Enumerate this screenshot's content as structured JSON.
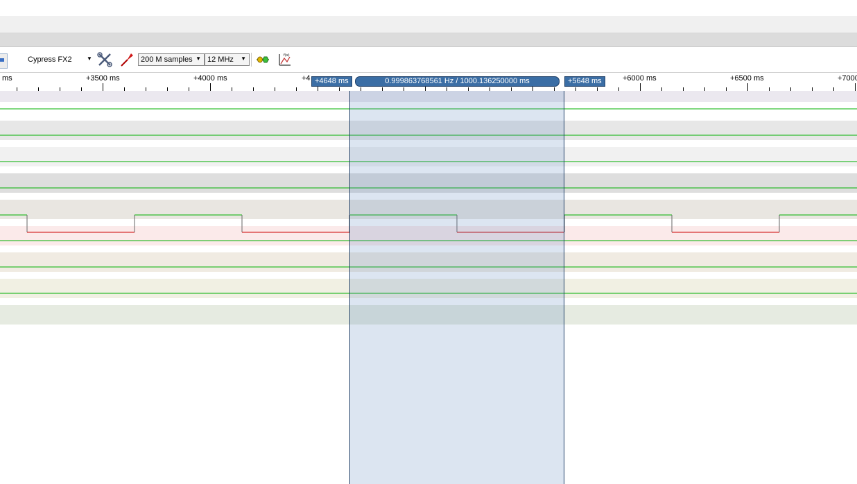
{
  "toolbar": {
    "device": "Cypress FX2",
    "samples": "200 M samples",
    "samplerate": "12 MHz",
    "icons": [
      "configure-tools-icon",
      "probe-icon",
      "decoder-icon",
      "math-function-icon"
    ]
  },
  "ruler": {
    "labels": [
      "ms",
      "+3500 ms",
      "+4000 ms",
      "+4",
      "+6000 ms",
      "+6500 ms",
      "+7000"
    ]
  },
  "cursors": {
    "left": "+4648 ms",
    "right": "+5648 ms",
    "measurement": "0.999863768561 Hz / 1000.136250000 ms"
  },
  "waveform": {
    "period_ms": 1000.13625,
    "cursor_left_ms": 4648,
    "cursor_right_ms": 5648,
    "active_channel_index": 5
  },
  "colors": {
    "signal_high": "#00b000",
    "signal_low": "#cc0000",
    "selection": "#5a82be",
    "marker": "#3b6ea5"
  }
}
